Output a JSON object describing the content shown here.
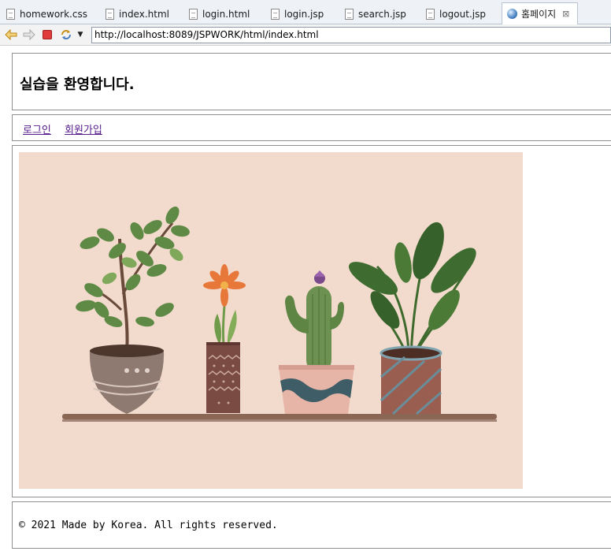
{
  "editor_tabs": [
    {
      "label": "homework.css"
    },
    {
      "label": "index.html"
    },
    {
      "label": "login.html"
    },
    {
      "label": "login.jsp"
    },
    {
      "label": "search.jsp"
    },
    {
      "label": "logout.jsp"
    },
    {
      "label": "홈페이지",
      "active": true
    }
  ],
  "browser": {
    "url": "http://localhost:8089/JSPWORK/html/index.html",
    "back_icon": "arrow-left",
    "forward_icon": "arrow-right",
    "stop_icon": "stop-square",
    "refresh_icon": "refresh-arrows"
  },
  "page": {
    "heading": "실습을 환영합니다.",
    "nav": {
      "login": "로그인",
      "signup": "회원가입"
    },
    "footer": "© 2021 Made by Korea. All rights reserved."
  },
  "colors": {
    "illustration_bg": "#f2dbcd",
    "link_visited": "#551a8b",
    "stop_red": "#e23b3b"
  }
}
